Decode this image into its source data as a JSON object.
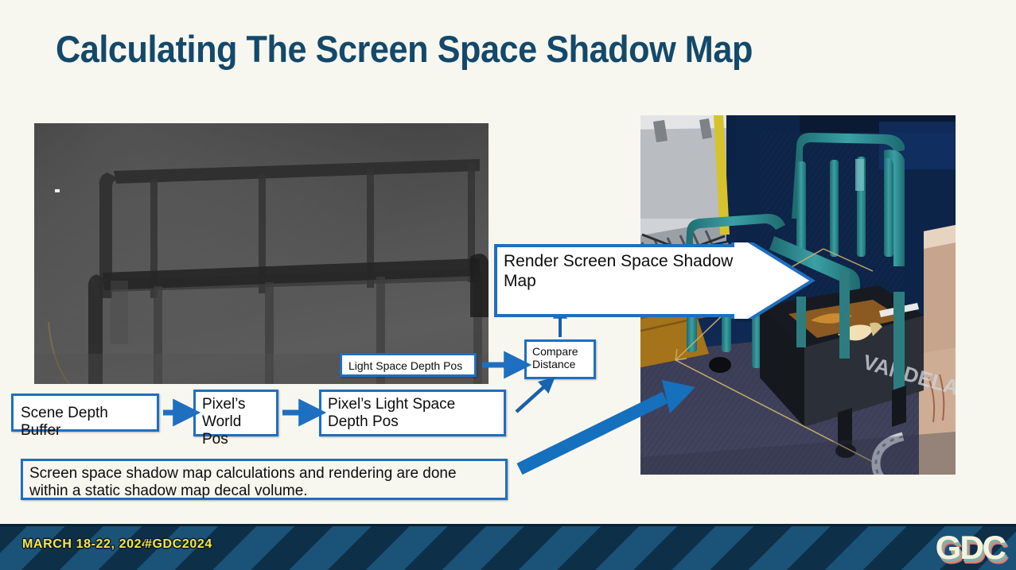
{
  "slide": {
    "title": "Calculating The Screen Space Shadow Map",
    "background_color": "#f8f7ef",
    "accent_color": "#1f6fc0",
    "title_color": "#13496b"
  },
  "images": {
    "depth_buffer": {
      "name": "scene-depth-buffer-image",
      "description": "Grayscale depth buffer render showing a railing silhouette"
    },
    "rendered_scene": {
      "name": "rendered-scene-image",
      "description": "Cel-shaded game scene with teal railings, cart and shadow decal volume",
      "cart_label": "VANDELAY"
    }
  },
  "flow": {
    "light_space_depth_pos": "Light Space Depth Pos",
    "compare_distance": "Compare\nDistance",
    "compare_distance_line1": "Compare",
    "compare_distance_line2": "Distance",
    "scene_depth_buffer": "Scene Depth Buffer",
    "pixels_world_pos_line1": "Pixel’s",
    "pixels_world_pos_line2": "World Pos",
    "pixels_light_space_depth_pos": "Pixel’s Light Space Depth Pos",
    "render_callout": "Render Screen Space Shadow Map",
    "caption": "Screen space shadow map calculations and rendering are done within a static shadow map decal volume."
  },
  "footer": {
    "date": "MARCH 18-22, 2024",
    "hashtag": "#GDC2024",
    "logo": "GDC",
    "stripe_light": "#1a5278",
    "stripe_dark": "#0d3048",
    "text_color": "#f6e54a"
  }
}
